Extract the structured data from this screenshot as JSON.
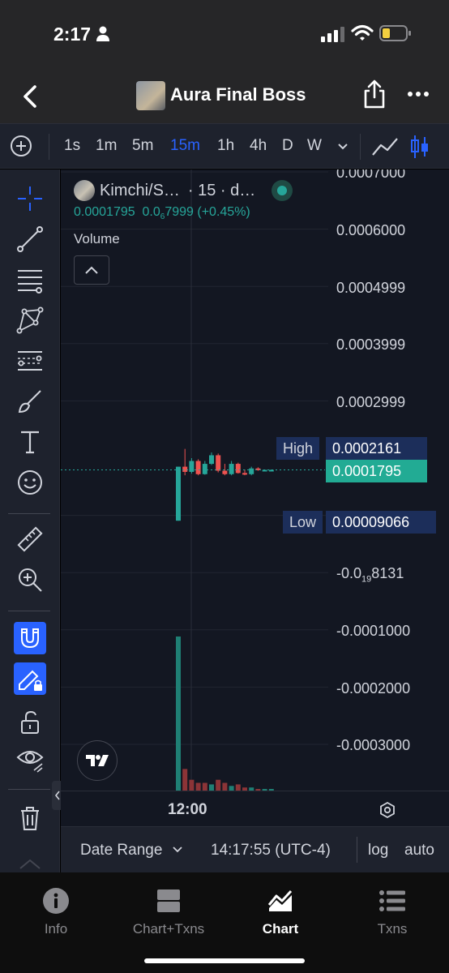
{
  "status_bar": {
    "time": "2:17"
  },
  "header": {
    "title": "Aura Final Boss"
  },
  "timeframes": [
    {
      "label": "1s",
      "active": false
    },
    {
      "label": "1m",
      "active": false
    },
    {
      "label": "5m",
      "active": false
    },
    {
      "label": "15m",
      "active": true
    },
    {
      "label": "1h",
      "active": false
    },
    {
      "label": "4h",
      "active": false
    },
    {
      "label": "D",
      "active": false
    },
    {
      "label": "W",
      "active": false
    }
  ],
  "legend": {
    "symbol": "Kimchi/S…",
    "interval": "· 15 · d…",
    "price": "0.0001795",
    "change_prefix": "0.0",
    "change_sub": "6",
    "change_rest": "7999 (+0.45%)",
    "volume_label": "Volume"
  },
  "price_axis": [
    {
      "text": "0.0007000"
    },
    {
      "text": "0.0006000"
    },
    {
      "text": "0.0004999"
    },
    {
      "text": "0.0003999"
    },
    {
      "text": "0.0002999"
    },
    {
      "prefix": "-0.0",
      "sub": "19",
      "rest": "8131"
    },
    {
      "text": "-0.0001000"
    },
    {
      "text": "-0.0002000"
    },
    {
      "text": "-0.0003000"
    }
  ],
  "markers": {
    "high_label": "High",
    "high_value": "0.0002161",
    "current_value": "0.0001795",
    "low_label": "Low",
    "low_value": "0.00009066"
  },
  "time_axis": {
    "label": "12:00"
  },
  "bottom_controls": {
    "date_range": "Date Range",
    "clock": "14:17:55 (UTC-4)",
    "log": "log",
    "auto": "auto"
  },
  "tabs": [
    {
      "label": "Info",
      "icon": "info-icon",
      "active": false
    },
    {
      "label": "Chart+Txns",
      "icon": "chart-txns-icon",
      "active": false
    },
    {
      "label": "Chart",
      "icon": "chart-icon",
      "active": true
    },
    {
      "label": "Txns",
      "icon": "list-icon",
      "active": false
    }
  ],
  "colors": {
    "up": "#26a69a",
    "down": "#ef5350",
    "accent": "#2962ff",
    "chart_bg": "#131722",
    "panel_bg": "#1e222d"
  },
  "chart_data": {
    "type": "candlestick",
    "price_range": [
      -0.0003,
      0.0007
    ],
    "high": 0.0002161,
    "low": 9.066e-05,
    "last": 0.0001795,
    "candles": [
      {
        "open": 9.066e-05,
        "high": 0.000185,
        "low": 9.066e-05,
        "close": 0.000185
      },
      {
        "open": 0.000185,
        "high": 0.0002161,
        "low": 0.00017,
        "close": 0.000176
      },
      {
        "open": 0.000176,
        "high": 0.0002,
        "low": 0.000173,
        "close": 0.000195
      },
      {
        "open": 0.000195,
        "high": 0.000198,
        "low": 0.00017,
        "close": 0.000172
      },
      {
        "open": 0.000172,
        "high": 0.000195,
        "low": 0.000171,
        "close": 0.00019
      },
      {
        "open": 0.00019,
        "high": 0.00021,
        "low": 0.000188,
        "close": 0.000205
      },
      {
        "open": 0.000205,
        "high": 0.000208,
        "low": 0.000175,
        "close": 0.000178
      },
      {
        "open": 0.000178,
        "high": 0.00019,
        "low": 0.00017,
        "close": 0.000172
      },
      {
        "open": 0.000172,
        "high": 0.000195,
        "low": 0.00017,
        "close": 0.00019
      },
      {
        "open": 0.00019,
        "high": 0.000192,
        "low": 0.000173,
        "close": 0.000174
      },
      {
        "open": 0.000174,
        "high": 0.00018,
        "low": 0.00017,
        "close": 0.000172
      },
      {
        "open": 0.000172,
        "high": 0.000185,
        "low": 0.00017,
        "close": 0.000182
      },
      {
        "open": 0.000182,
        "high": 0.000184,
        "low": 0.000178,
        "close": 0.000179
      },
      {
        "open": 0.000179,
        "high": 0.00018,
        "low": 0.000178,
        "close": 0.0001795
      },
      {
        "open": 0.0001795,
        "high": 0.00018,
        "low": 0.000179,
        "close": 0.0001795
      }
    ],
    "volume": [
      1.0,
      0.14,
      0.07,
      0.05,
      0.05,
      0.04,
      0.07,
      0.05,
      0.03,
      0.04,
      0.02,
      0.02,
      0.01,
      0.01,
      0.01
    ],
    "volume_dir": [
      "up",
      "down",
      "down",
      "down",
      "down",
      "up",
      "down",
      "down",
      "up",
      "down",
      "down",
      "up",
      "down",
      "up",
      "up"
    ]
  }
}
